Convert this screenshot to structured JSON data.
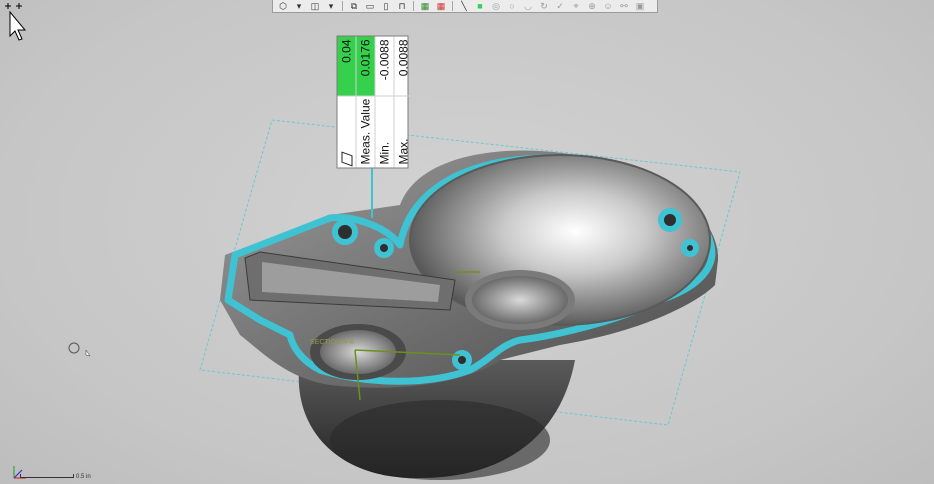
{
  "toolbar": {
    "buttons": [
      {
        "name": "view-shaded-icon"
      },
      {
        "name": "view-wire-icon"
      },
      {
        "name": "view-box-icon"
      },
      {
        "name": "view-iso-icon"
      },
      {
        "name": "view-front-icon"
      },
      {
        "name": "view-top-icon"
      },
      {
        "name": "view-side-icon"
      },
      {
        "name": "part-icon"
      },
      {
        "name": "grid-icon"
      },
      {
        "name": "grid-color-icon"
      },
      {
        "name": "line-icon"
      },
      {
        "name": "green-square-icon"
      },
      {
        "name": "target-icon"
      },
      {
        "name": "circle-icon"
      },
      {
        "name": "curve-icon"
      },
      {
        "name": "rotate-icon"
      },
      {
        "name": "check-icon"
      },
      {
        "name": "measure-icon"
      },
      {
        "name": "zoom-icon"
      },
      {
        "name": "person-icon"
      },
      {
        "name": "link-icon"
      },
      {
        "name": "lock-icon"
      }
    ]
  },
  "measurement": {
    "tolerance": "0.04",
    "rows": [
      {
        "label": "Meas. Value",
        "value": "0.0176"
      },
      {
        "label": "Min.",
        "value": "-0.0088"
      },
      {
        "label": "Max.",
        "value": "0.0088"
      }
    ]
  },
  "labels": {
    "section": "SECTION A-A",
    "scale": "0.5 in"
  },
  "colors": {
    "plane": "#5fc8d6",
    "highlight": "#3fc2d2",
    "accent_green": "#35d14c"
  }
}
